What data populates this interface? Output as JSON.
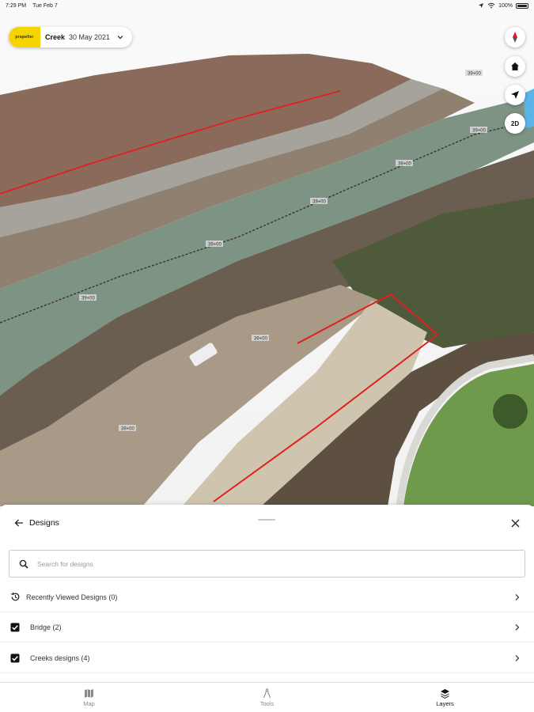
{
  "status_bar": {
    "time": "7:29 PM",
    "date": "Tue Feb 7",
    "battery": "100%"
  },
  "project": {
    "logo_text": "propeller",
    "name": "Creek",
    "date": "30 May 2021"
  },
  "map_controls": {
    "dimension_label": "2D"
  },
  "map_labels": {
    "chainage_values": [
      "39+00",
      "39+00",
      "39+00",
      "39+00",
      "39+00",
      "39+00",
      "39+00",
      "39+00"
    ]
  },
  "designs_panel": {
    "title": "Designs",
    "search_placeholder": "Search for designs",
    "rows": [
      {
        "label": "Recently Viewed Designs (0)",
        "icon": "history-icon",
        "checked": null
      },
      {
        "label": "Bridge (2)",
        "icon": "checkbox-icon",
        "checked": true
      },
      {
        "label": "Creeks designs (4)",
        "icon": "checkbox-icon",
        "checked": true
      }
    ]
  },
  "tabs": [
    {
      "label": "Map",
      "icon": "map-icon",
      "active": false
    },
    {
      "label": "Tools",
      "icon": "tools-icon",
      "active": false
    },
    {
      "label": "Layers",
      "icon": "layers-icon",
      "active": true
    }
  ],
  "colors": {
    "brand_yellow": "#f5d400",
    "design_line_red": "#e02020",
    "water": "#7d9384",
    "grass": "#6f9a4c"
  }
}
